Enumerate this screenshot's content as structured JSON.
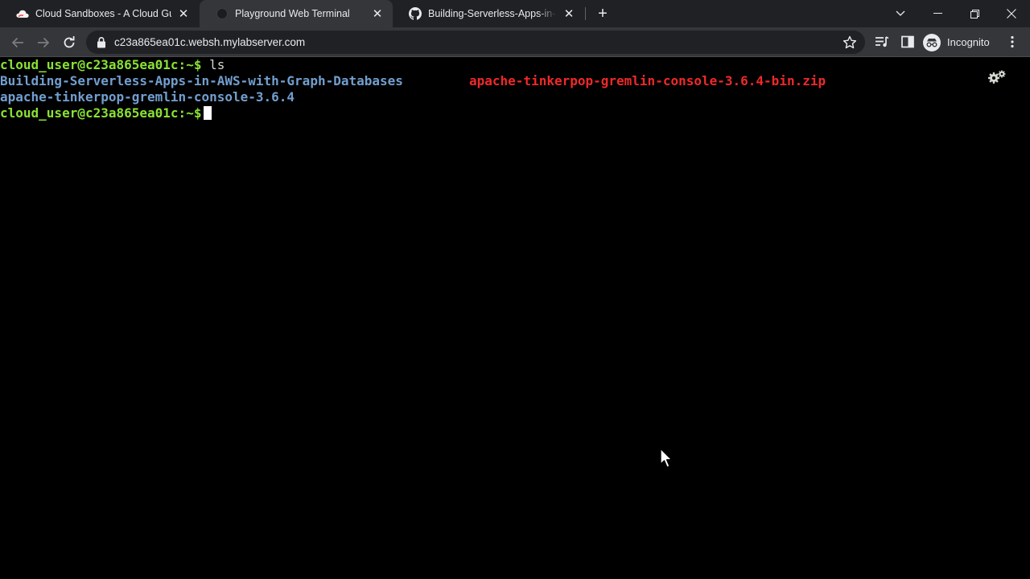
{
  "browser": {
    "tabs": [
      {
        "title": "Cloud Sandboxes - A Cloud Guru",
        "icon": "acloudguru-cloud-icon",
        "active": false
      },
      {
        "title": "Playground Web Terminal",
        "icon": "terminal-favicon-icon",
        "active": true
      },
      {
        "title": "Building-Serverless-Apps-in-AWS",
        "icon": "github-icon",
        "active": false
      }
    ],
    "address": "c23a865ea01c.websh.mylabserver.com",
    "profile_label": "Incognito"
  },
  "terminal": {
    "prompt": "cloud_user@c23a865ea01c:~$",
    "command": "ls",
    "entries": {
      "dir1": "Building-Serverless-Apps-in-AWS-with-Graph-Databases",
      "zip": "apache-tinkerpop-gremlin-console-3.6.4-bin.zip",
      "dir2": "apache-tinkerpop-gremlin-console-3.6.4"
    },
    "colors": {
      "prompt": "#8ae234",
      "directory": "#729fcf",
      "archive": "#ef2929",
      "background": "#000000"
    }
  }
}
